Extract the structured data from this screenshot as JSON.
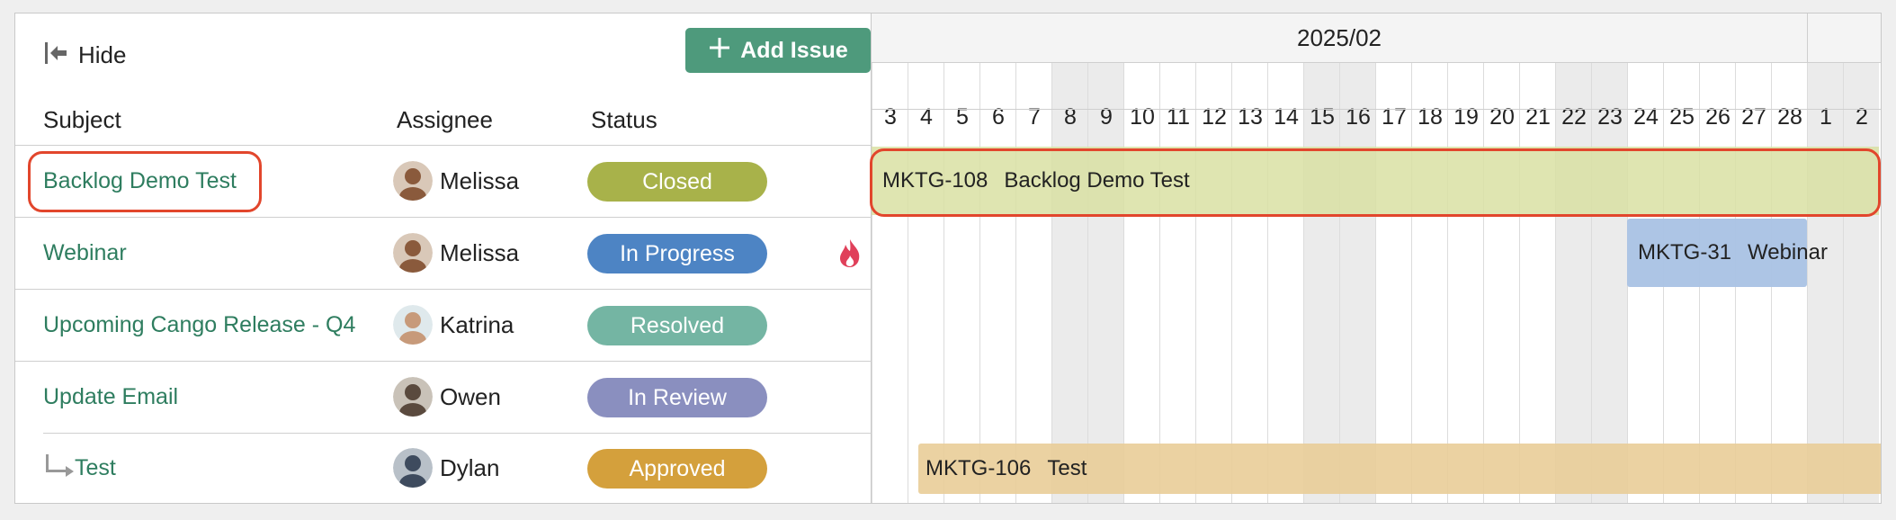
{
  "toolbar": {
    "hide_label": "Hide",
    "add_issue_label": "Add Issue"
  },
  "columns": {
    "subject": "Subject",
    "assignee": "Assignee",
    "status": "Status"
  },
  "issues": [
    {
      "subject": "Backlog Demo Test",
      "assignee": "Melissa",
      "status": "Closed",
      "status_color": "#a8b24a",
      "avatar_color": "#8a5a3c",
      "highlighted": true
    },
    {
      "subject": "Webinar",
      "assignee": "Melissa",
      "status": "In Progress",
      "status_color": "#4d84c4",
      "avatar_color": "#8a5a3c",
      "priority_icon": "fire-icon"
    },
    {
      "subject": "Upcoming Cango Release - Q4",
      "assignee": "Katrina",
      "status": "Resolved",
      "status_color": "#74b5a3",
      "avatar_color": "#c79a7a"
    },
    {
      "subject": "Update Email",
      "assignee": "Owen",
      "status": "In Review",
      "status_color": "#8a8fbf",
      "avatar_color": "#5a4a3e"
    },
    {
      "subject": "Test",
      "assignee": "Dylan",
      "status": "Approved",
      "status_color": "#d4a03c",
      "avatar_color": "#3e4b5e",
      "is_subtask": true
    }
  ],
  "gantt": {
    "month": "2025/02",
    "days": [
      "3",
      "4",
      "5",
      "6",
      "7",
      "8",
      "9",
      "10",
      "11",
      "12",
      "13",
      "14",
      "15",
      "16",
      "17",
      "18",
      "19",
      "20",
      "21",
      "22",
      "23",
      "24",
      "25",
      "26",
      "27",
      "28",
      "1",
      "2"
    ],
    "weekend_days": [
      "8",
      "9",
      "15",
      "16",
      "22",
      "23",
      "1",
      "2"
    ],
    "bars": [
      {
        "key": "MKTG-108",
        "title": "Backlog Demo Test",
        "color": "#d9e0a3",
        "highlighted": true
      },
      {
        "key": "MKTG-31",
        "title": "Webinar",
        "color": "#a9c2e4"
      },
      {
        "key": "MKTG-106",
        "title": "Test",
        "color": "#e9cd98"
      }
    ]
  }
}
